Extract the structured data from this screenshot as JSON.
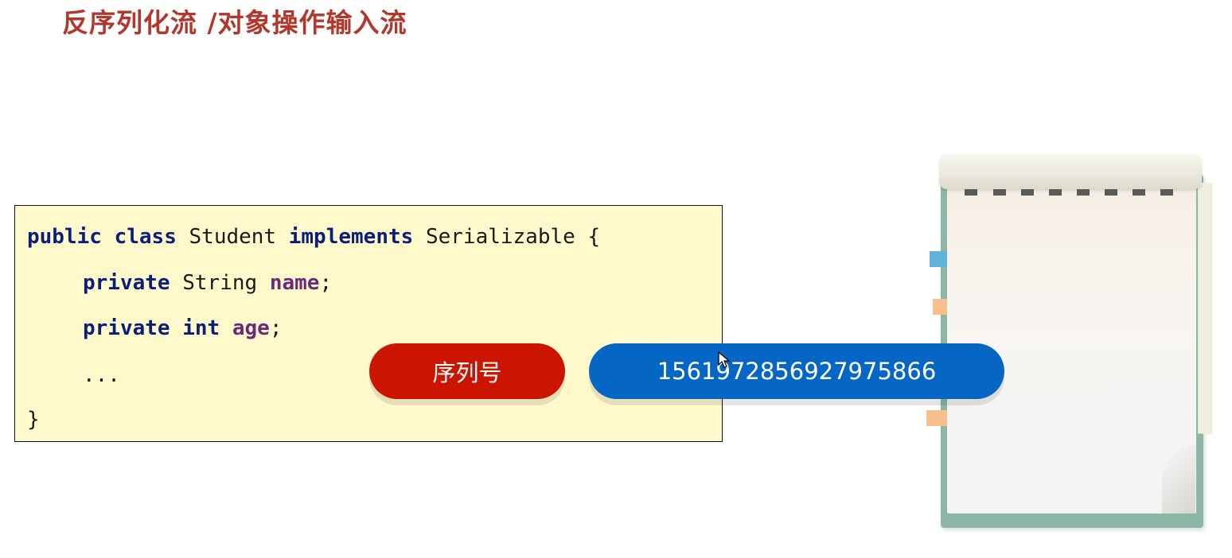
{
  "slide": {
    "title": "反序列化流 /对象操作输入流"
  },
  "code": {
    "line1": {
      "kw1": "public",
      "kw2": "class",
      "name": "Student",
      "kw3": "implements",
      "iface": "Serializable {"
    },
    "line2": {
      "kw": "private",
      "type": "String",
      "field": "name",
      "end": ";"
    },
    "line3": {
      "kw1": "private",
      "kw2": "int",
      "field": "age",
      "end": ";"
    },
    "line4": "...",
    "line5": "}"
  },
  "labels": {
    "serial_label": "序列号",
    "serial_value": "1561972856927975866"
  },
  "colors": {
    "title": "#b2372c",
    "code_bg": "#fff9cc",
    "keyword": "#0b1f7a",
    "field": "#6a2a7a",
    "pill_red": "#cc1500",
    "pill_blue": "#0566c4",
    "notebook_cover": "#8db7a5"
  },
  "icons": {
    "cursor": "mouse-pointer-icon"
  }
}
